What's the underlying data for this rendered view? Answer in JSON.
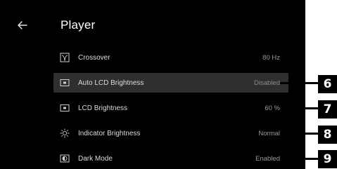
{
  "header": {
    "title": "Player",
    "back_icon": "arrow-left-icon"
  },
  "settings": [
    {
      "label": "Crossover",
      "value": "80 Hz",
      "icon": "crossover-icon",
      "selected": false
    },
    {
      "label": "Auto LCD Brightness",
      "value": "Disabled",
      "icon": "lcd-icon",
      "selected": true
    },
    {
      "label": "LCD Brightness",
      "value": "60 %",
      "icon": "lcd-icon",
      "selected": false
    },
    {
      "label": "Indicator Brightness",
      "value": "Normal",
      "icon": "sun-icon",
      "selected": false
    },
    {
      "label": "Dark Mode",
      "value": "Enabled",
      "icon": "contrast-icon",
      "selected": false
    }
  ],
  "callouts": [
    "6",
    "7",
    "8",
    "9"
  ],
  "colors": {
    "screen_bg": "#000000",
    "selected_row": "#2f2f2f",
    "text": "#dcdcdc",
    "value_text": "#9a9a9a"
  }
}
